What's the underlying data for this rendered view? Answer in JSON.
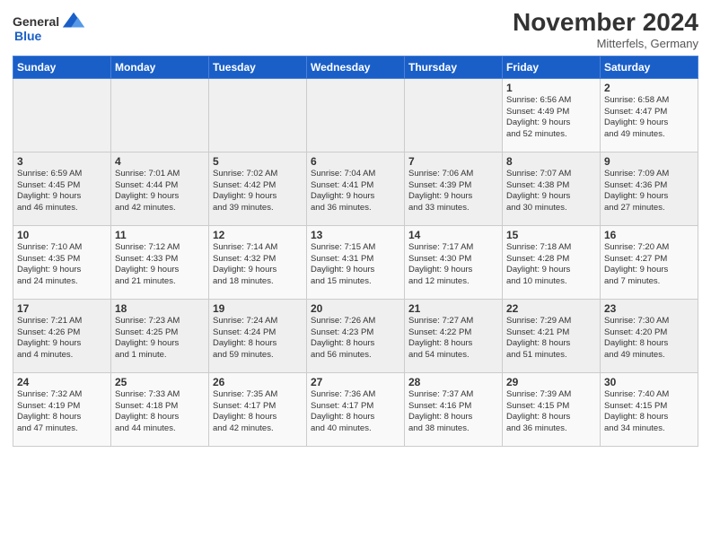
{
  "header": {
    "logo_general": "General",
    "logo_blue": "Blue",
    "month_title": "November 2024",
    "location": "Mitterfels, Germany"
  },
  "weekdays": [
    "Sunday",
    "Monday",
    "Tuesday",
    "Wednesday",
    "Thursday",
    "Friday",
    "Saturday"
  ],
  "weeks": [
    [
      {
        "day": "",
        "info": ""
      },
      {
        "day": "",
        "info": ""
      },
      {
        "day": "",
        "info": ""
      },
      {
        "day": "",
        "info": ""
      },
      {
        "day": "",
        "info": ""
      },
      {
        "day": "1",
        "info": "Sunrise: 6:56 AM\nSunset: 4:49 PM\nDaylight: 9 hours\nand 52 minutes."
      },
      {
        "day": "2",
        "info": "Sunrise: 6:58 AM\nSunset: 4:47 PM\nDaylight: 9 hours\nand 49 minutes."
      }
    ],
    [
      {
        "day": "3",
        "info": "Sunrise: 6:59 AM\nSunset: 4:45 PM\nDaylight: 9 hours\nand 46 minutes."
      },
      {
        "day": "4",
        "info": "Sunrise: 7:01 AM\nSunset: 4:44 PM\nDaylight: 9 hours\nand 42 minutes."
      },
      {
        "day": "5",
        "info": "Sunrise: 7:02 AM\nSunset: 4:42 PM\nDaylight: 9 hours\nand 39 minutes."
      },
      {
        "day": "6",
        "info": "Sunrise: 7:04 AM\nSunset: 4:41 PM\nDaylight: 9 hours\nand 36 minutes."
      },
      {
        "day": "7",
        "info": "Sunrise: 7:06 AM\nSunset: 4:39 PM\nDaylight: 9 hours\nand 33 minutes."
      },
      {
        "day": "8",
        "info": "Sunrise: 7:07 AM\nSunset: 4:38 PM\nDaylight: 9 hours\nand 30 minutes."
      },
      {
        "day": "9",
        "info": "Sunrise: 7:09 AM\nSunset: 4:36 PM\nDaylight: 9 hours\nand 27 minutes."
      }
    ],
    [
      {
        "day": "10",
        "info": "Sunrise: 7:10 AM\nSunset: 4:35 PM\nDaylight: 9 hours\nand 24 minutes."
      },
      {
        "day": "11",
        "info": "Sunrise: 7:12 AM\nSunset: 4:33 PM\nDaylight: 9 hours\nand 21 minutes."
      },
      {
        "day": "12",
        "info": "Sunrise: 7:14 AM\nSunset: 4:32 PM\nDaylight: 9 hours\nand 18 minutes."
      },
      {
        "day": "13",
        "info": "Sunrise: 7:15 AM\nSunset: 4:31 PM\nDaylight: 9 hours\nand 15 minutes."
      },
      {
        "day": "14",
        "info": "Sunrise: 7:17 AM\nSunset: 4:30 PM\nDaylight: 9 hours\nand 12 minutes."
      },
      {
        "day": "15",
        "info": "Sunrise: 7:18 AM\nSunset: 4:28 PM\nDaylight: 9 hours\nand 10 minutes."
      },
      {
        "day": "16",
        "info": "Sunrise: 7:20 AM\nSunset: 4:27 PM\nDaylight: 9 hours\nand 7 minutes."
      }
    ],
    [
      {
        "day": "17",
        "info": "Sunrise: 7:21 AM\nSunset: 4:26 PM\nDaylight: 9 hours\nand 4 minutes."
      },
      {
        "day": "18",
        "info": "Sunrise: 7:23 AM\nSunset: 4:25 PM\nDaylight: 9 hours\nand 1 minute."
      },
      {
        "day": "19",
        "info": "Sunrise: 7:24 AM\nSunset: 4:24 PM\nDaylight: 8 hours\nand 59 minutes."
      },
      {
        "day": "20",
        "info": "Sunrise: 7:26 AM\nSunset: 4:23 PM\nDaylight: 8 hours\nand 56 minutes."
      },
      {
        "day": "21",
        "info": "Sunrise: 7:27 AM\nSunset: 4:22 PM\nDaylight: 8 hours\nand 54 minutes."
      },
      {
        "day": "22",
        "info": "Sunrise: 7:29 AM\nSunset: 4:21 PM\nDaylight: 8 hours\nand 51 minutes."
      },
      {
        "day": "23",
        "info": "Sunrise: 7:30 AM\nSunset: 4:20 PM\nDaylight: 8 hours\nand 49 minutes."
      }
    ],
    [
      {
        "day": "24",
        "info": "Sunrise: 7:32 AM\nSunset: 4:19 PM\nDaylight: 8 hours\nand 47 minutes."
      },
      {
        "day": "25",
        "info": "Sunrise: 7:33 AM\nSunset: 4:18 PM\nDaylight: 8 hours\nand 44 minutes."
      },
      {
        "day": "26",
        "info": "Sunrise: 7:35 AM\nSunset: 4:17 PM\nDaylight: 8 hours\nand 42 minutes."
      },
      {
        "day": "27",
        "info": "Sunrise: 7:36 AM\nSunset: 4:17 PM\nDaylight: 8 hours\nand 40 minutes."
      },
      {
        "day": "28",
        "info": "Sunrise: 7:37 AM\nSunset: 4:16 PM\nDaylight: 8 hours\nand 38 minutes."
      },
      {
        "day": "29",
        "info": "Sunrise: 7:39 AM\nSunset: 4:15 PM\nDaylight: 8 hours\nand 36 minutes."
      },
      {
        "day": "30",
        "info": "Sunrise: 7:40 AM\nSunset: 4:15 PM\nDaylight: 8 hours\nand 34 minutes."
      }
    ]
  ]
}
